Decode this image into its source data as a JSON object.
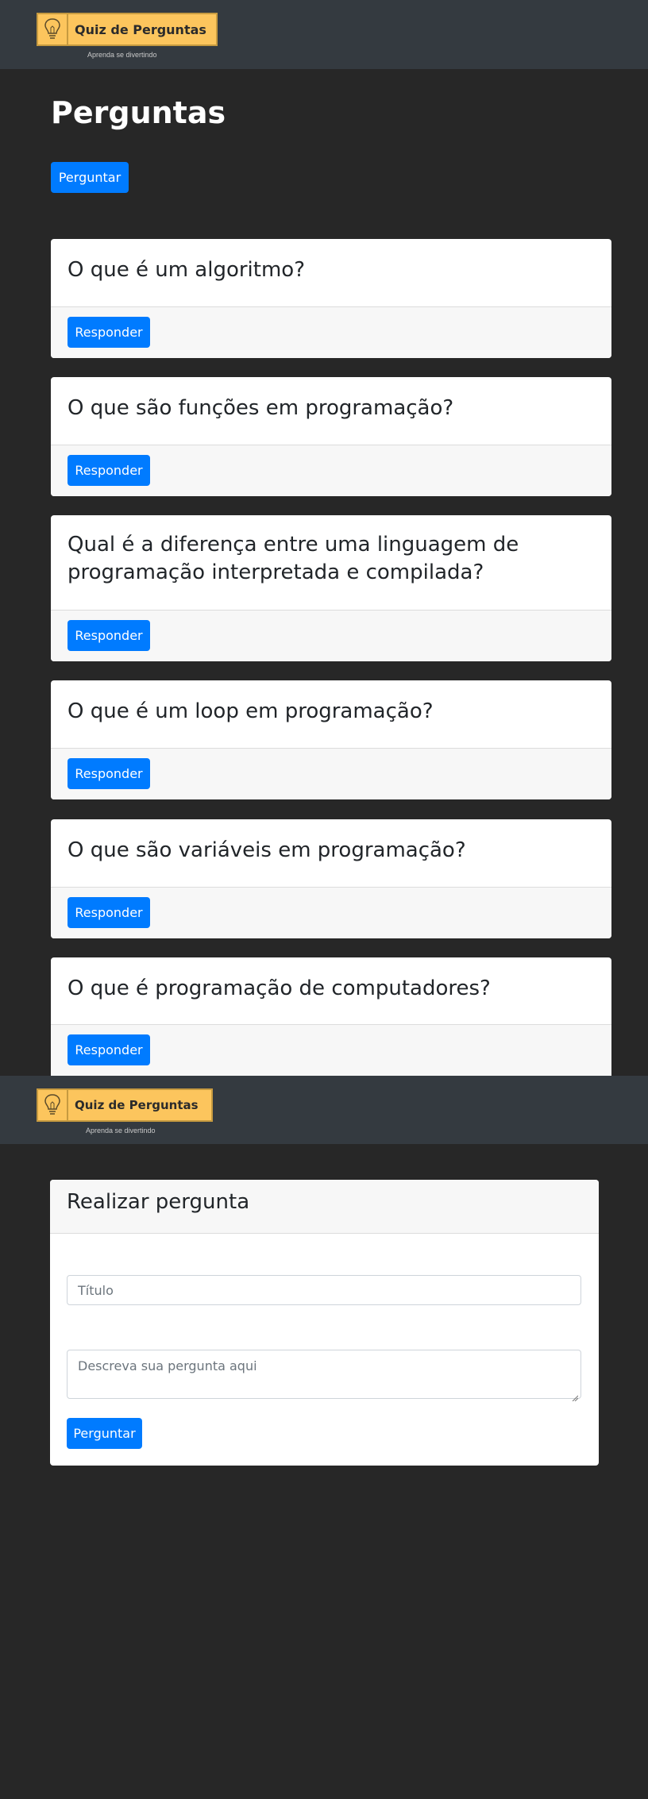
{
  "header": {
    "logo_title": "Quiz de Perguntas",
    "logo_subtitle": "Aprenda se divertindo",
    "logo_icon": "lightbulb-icon"
  },
  "questions_page": {
    "title": "Perguntas",
    "ask_button": "Perguntar",
    "questions": [
      {
        "title": "O que é um algoritmo?",
        "button": "Responder"
      },
      {
        "title": "O que são funções em programação?",
        "button": "Responder"
      },
      {
        "title": "Qual é a diferença entre uma linguagem de programação interpretada e compilada?",
        "button": "Responder"
      },
      {
        "title": "O que é um loop em programação?",
        "button": "Responder"
      },
      {
        "title": "O que são variáveis em programação?",
        "button": "Responder"
      },
      {
        "title": "O que é programação de computadores?",
        "button": "Responder"
      }
    ]
  },
  "ask_page": {
    "card_title": "Realizar pergunta",
    "title_placeholder": "Título",
    "description_placeholder": "Descreva sua pergunta aqui",
    "submit_button": "Perguntar"
  },
  "colors": {
    "background": "#272727",
    "navbar": "#343a40",
    "logo_bg": "#fcc55d",
    "primary": "#007bff"
  }
}
